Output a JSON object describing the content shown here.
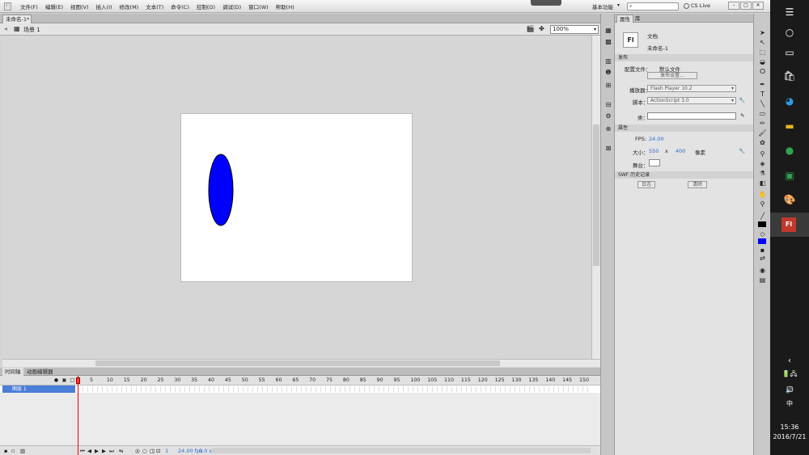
{
  "app": {
    "logo": "Fl"
  },
  "menu": [
    "文件(F)",
    "编辑(E)",
    "视图(V)",
    "插入(I)",
    "修改(M)",
    "文本(T)",
    "命令(C)",
    "控制(O)",
    "调试(D)",
    "窗口(W)",
    "帮助(H)"
  ],
  "header": {
    "workspace": "基本功能",
    "workspace_chevron": "▾",
    "cs_live": "CS Live",
    "search_icon": "⌕",
    "window_buttons": [
      "–",
      "□",
      "✕"
    ]
  },
  "document": {
    "tab": "未命名-1*",
    "scene": "场景 1",
    "zoom": "100%"
  },
  "stage_colors": {
    "stage": "#ffffff",
    "ellipse_fill": "#0000ff",
    "ellipse_stroke": "#000000"
  },
  "timeline": {
    "tabs": [
      "时间轴",
      "动画编辑器"
    ],
    "ticks": [
      "5",
      "10",
      "15",
      "20",
      "25",
      "30",
      "35",
      "40",
      "45",
      "50",
      "55",
      "60",
      "65",
      "70",
      "75",
      "80",
      "85",
      "90",
      "95",
      "100",
      "105",
      "110",
      "115",
      "120",
      "125",
      "130",
      "135",
      "140",
      "145",
      "150"
    ],
    "layer": "图层 1",
    "current_frame": "1",
    "fps": "24.00 fps",
    "elapsed": "0.0 s"
  },
  "properties": {
    "tabs": [
      "属性",
      "库"
    ],
    "doc_icon": "Fl",
    "doc_type": "文档",
    "doc_name": "未命名-1",
    "publish_section": "发布",
    "profile_label": "配置文件：",
    "profile_value": "默认文件",
    "publish_settings": "发布设置...",
    "player_label": "播放器：",
    "player_value": "Flash Player 10.2",
    "script_label": "脚本：",
    "script_value": "ActionScript 3.0",
    "class_label": "类：",
    "properties_section": "属性",
    "fps_label": "FPS:",
    "fps_value": "24.00",
    "size_label": "大小：",
    "width": "550",
    "x": "x",
    "height": "400",
    "unit": "像素",
    "stage_label": "舞台：",
    "swf_section": "SWF 历史记录",
    "log_btn": "日志",
    "clear_btn": "清除"
  },
  "taskbar": {
    "time": "15:36",
    "date": "2016/7/21",
    "ime": "中",
    "flash_icon": "Fl"
  }
}
